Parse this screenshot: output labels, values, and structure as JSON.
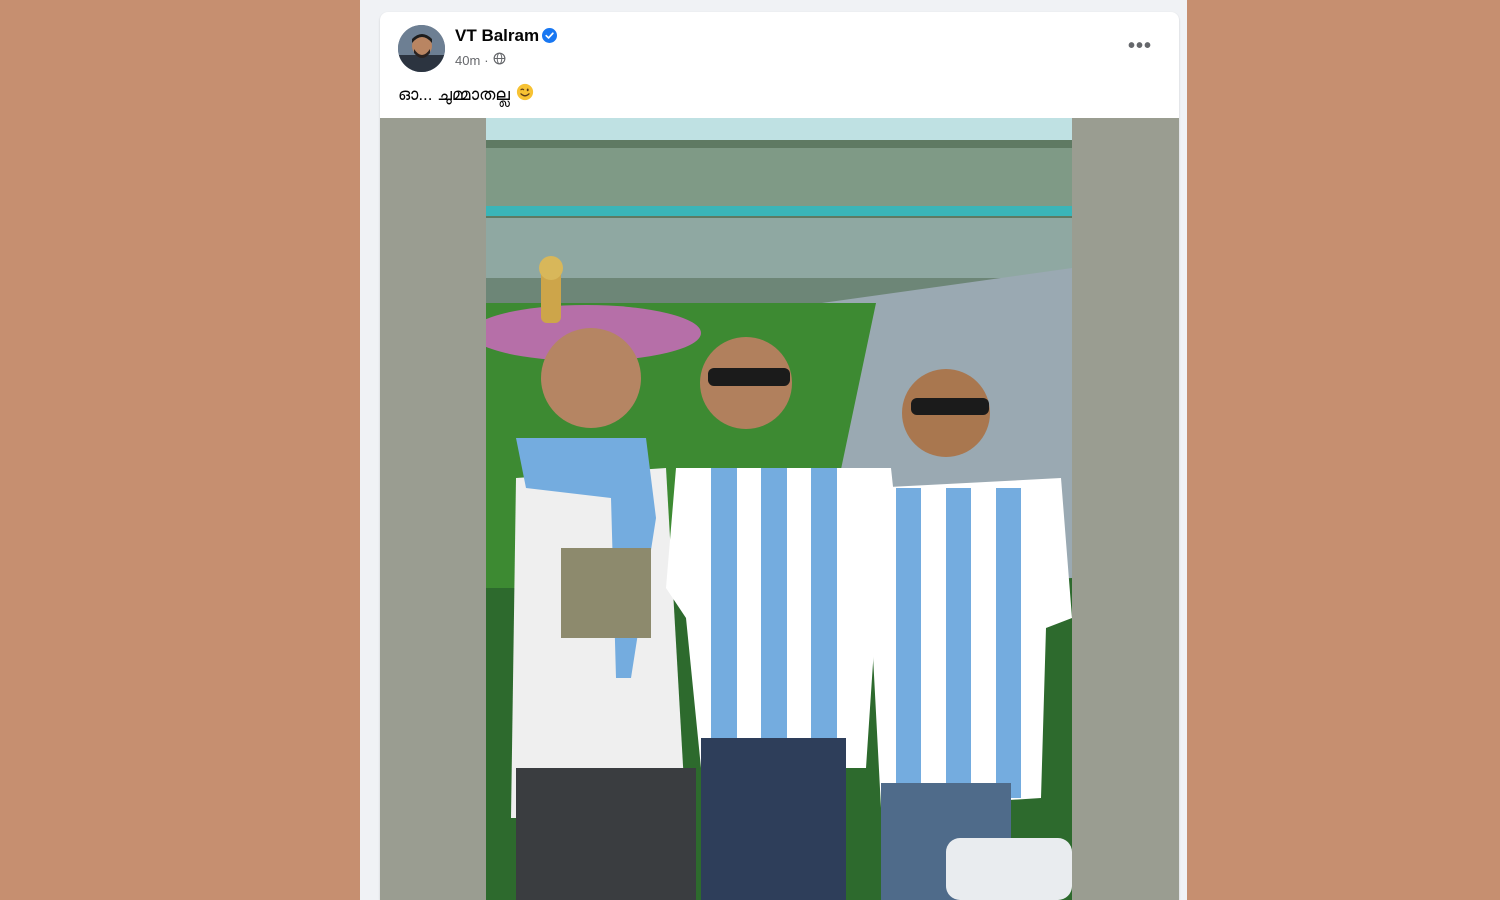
{
  "post": {
    "author": "VT Balram",
    "time": "40m",
    "separator": "·",
    "text": "ഓ... ചുമ്മാതല്ല",
    "more_label": "•••",
    "icons": {
      "verified": "verified-badge-icon",
      "audience": "globe-icon",
      "emoji": "winking-face-emoji-icon",
      "more": "more-options-icon"
    }
  },
  "colors": {
    "page_background": "#c68f70",
    "feed_background": "#f0f2f5",
    "verified_blue": "#1877f2",
    "photo_letterbox": "#9a9d91",
    "argentina_sky_blue": "#74acdf"
  }
}
